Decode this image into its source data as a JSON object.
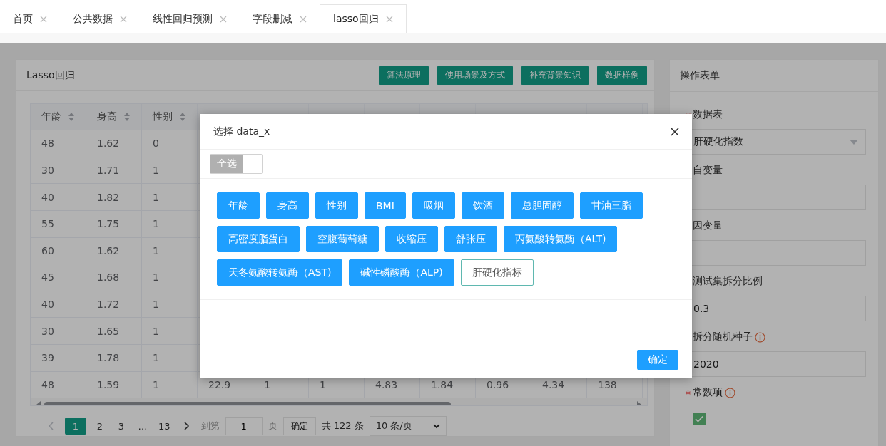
{
  "tabs": [
    {
      "label": "首页",
      "selected": false
    },
    {
      "label": "公共数据",
      "selected": false
    },
    {
      "label": "线性回归预测",
      "selected": false
    },
    {
      "label": "字段删减",
      "selected": false
    },
    {
      "label": "lasso回归",
      "selected": true
    }
  ],
  "card": {
    "title": "Lasso回归",
    "buttons": [
      "算法原理",
      "使用场景及方式",
      "补充背景知识",
      "数据样例"
    ]
  },
  "table": {
    "columns": [
      {
        "label": "年龄",
        "sortable": true
      },
      {
        "label": "身高",
        "sortable": true
      },
      {
        "label": "性别",
        "sortable": true
      },
      {},
      {},
      {},
      {},
      {},
      {},
      {},
      {}
    ],
    "rows": [
      [
        "48",
        "1.62",
        "0"
      ],
      [
        "30",
        "1.71",
        "1"
      ],
      [
        "40",
        "1.82",
        "1"
      ],
      [
        "55",
        "1.75",
        "1"
      ],
      [
        "60",
        "1.62",
        "1"
      ],
      [
        "45",
        "1.68",
        "1"
      ],
      [
        "40",
        "1.72",
        "1"
      ],
      [
        "30",
        "1.65",
        "1"
      ],
      [
        "39",
        "1.78",
        "1"
      ],
      [
        "48",
        "1.59",
        "1",
        "22.9",
        "1",
        "1",
        "4.83",
        "1.84",
        "0.96",
        "4.34",
        "138"
      ]
    ]
  },
  "pagination": {
    "pages": [
      {
        "label": "1",
        "selected": true
      },
      {
        "label": "2",
        "selected": false
      },
      {
        "label": "3",
        "selected": false
      },
      {
        "label": "…",
        "selected": false
      },
      {
        "label": "13",
        "selected": false
      }
    ],
    "goto_label": "到第",
    "goto_value": "1",
    "page_unit": "页",
    "confirm": "确定",
    "total": "共 122 条",
    "page_size": "10 条/页"
  },
  "form": {
    "title": "操作表单",
    "fields": [
      {
        "kind": "select",
        "label": "数据表",
        "required": true,
        "value": "肝硬化指数"
      },
      {
        "kind": "input",
        "label": "自变量",
        "required": false
      },
      {
        "kind": "input",
        "label": "因变量",
        "required": false
      },
      {
        "kind": "input",
        "label": "测试集拆分比例",
        "required": false,
        "value": "0.3"
      },
      {
        "kind": "input",
        "label": "拆分随机种子",
        "required": false,
        "info": true,
        "value": "2020"
      },
      {
        "kind": "checkbox",
        "label": "常数项",
        "required": true,
        "info": true,
        "checked": true
      }
    ]
  },
  "dialog": {
    "title": "选择 data_x",
    "select_all": {
      "label": "全选",
      "checked": false
    },
    "options": [
      {
        "label": "年龄",
        "selected": true
      },
      {
        "label": "身高",
        "selected": true
      },
      {
        "label": "性别",
        "selected": true
      },
      {
        "label": "BMI",
        "selected": true
      },
      {
        "label": "吸烟",
        "selected": true
      },
      {
        "label": "饮酒",
        "selected": true
      },
      {
        "label": "总胆固醇",
        "selected": true
      },
      {
        "label": "甘油三脂",
        "selected": true
      },
      {
        "label": "高密度脂蛋白",
        "selected": true
      },
      {
        "label": "空腹葡萄糖",
        "selected": true
      },
      {
        "label": "收缩压",
        "selected": true
      },
      {
        "label": "舒张压",
        "selected": true
      },
      {
        "label": "丙氨酸转氨酶（ALT)",
        "selected": true
      },
      {
        "label": "天冬氨酸转氨酶（AST)",
        "selected": true
      },
      {
        "label": "碱性磷酸酶（ALP)",
        "selected": true
      },
      {
        "label": "肝硬化指标",
        "selected": false
      }
    ],
    "confirm": "确定"
  }
}
